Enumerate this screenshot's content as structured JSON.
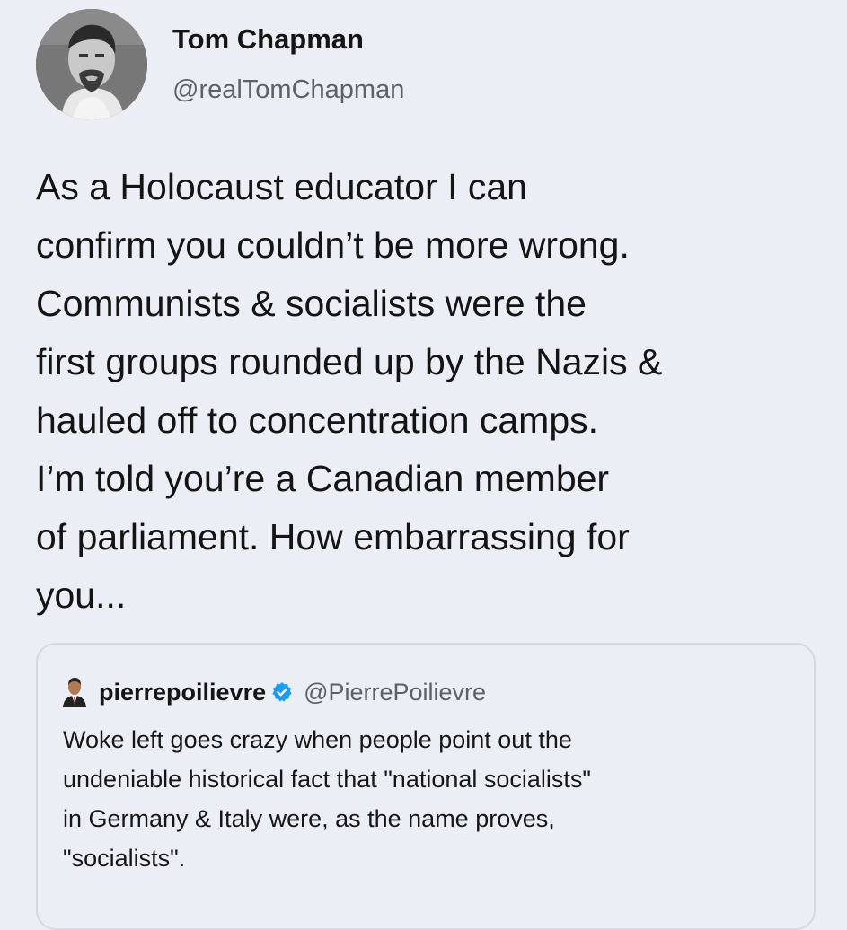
{
  "author": {
    "display_name": "Tom Chapman",
    "handle": "@realTomChapman",
    "avatar_icon": "profile-photo-icon"
  },
  "tweet": {
    "lines": [
      "As a Holocaust educator I can",
      "confirm you couldn’t be more wrong.",
      "Communists & socialists were the",
      "first groups rounded up by the Nazis &",
      "hauled off to concentration camps.",
      "I’m told you’re a Canadian member",
      "of parliament. How embarrassing for",
      "you..."
    ]
  },
  "quoted_tweet": {
    "display_name": "pierrepoilievre",
    "handle": "@PierrePoilievre",
    "verified_icon": "verified-badge-icon",
    "avatar_icon": "profile-photo-icon",
    "lines": [
      "Woke left goes crazy when people point out the",
      "undeniable historical fact that \"national socialists\"",
      "in Germany & Italy were, as the name proves,",
      "\"socialists\"."
    ]
  },
  "colors": {
    "background": "#eceef5",
    "verified_blue": "#1d9bf0",
    "handle_gray": "#5b6168"
  }
}
